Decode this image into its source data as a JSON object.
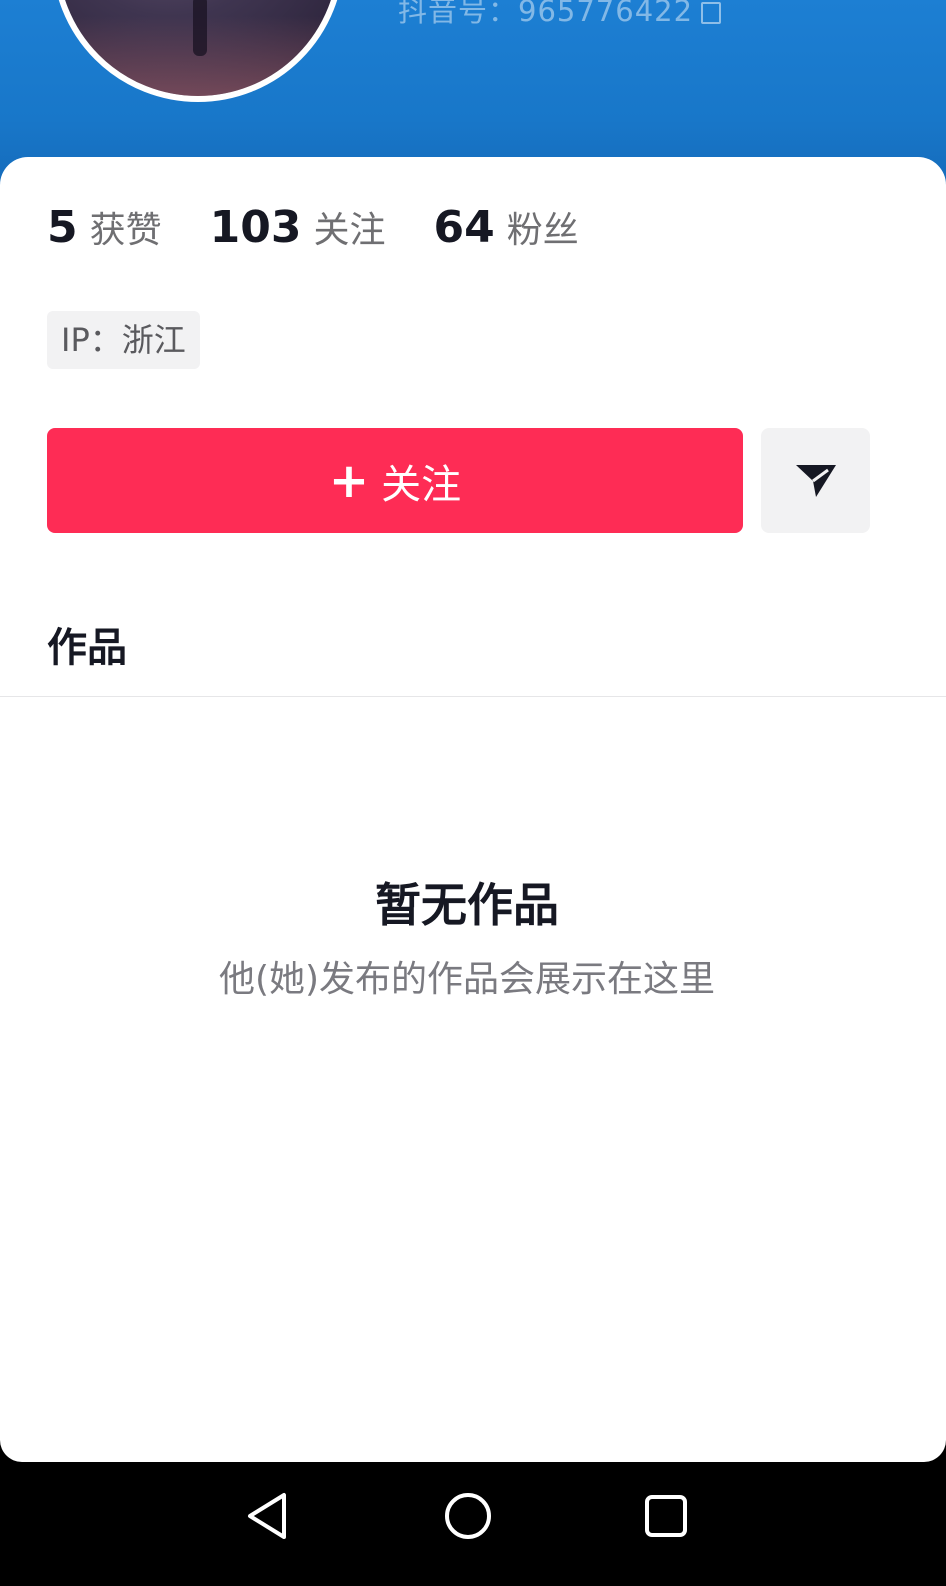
{
  "header": {
    "account_id": "抖音号：965776422",
    "avatar_icon": "avatar-image",
    "copy_icon": "copy-icon"
  },
  "stats": [
    {
      "value": "5",
      "label": "获赞"
    },
    {
      "value": "103",
      "label": "关注"
    },
    {
      "value": "64",
      "label": "粉丝"
    }
  ],
  "ip_location": "IP：浙江",
  "actions": {
    "follow_icon": "+",
    "follow_label": "关注",
    "message_icon": "send-icon"
  },
  "tabs": {
    "works_label": "作品"
  },
  "empty_state": {
    "title": "暂无作品",
    "subtitle": "他(她)发布的作品会展示在这里"
  },
  "nav": {
    "back_icon": "back-triangle-icon",
    "home_icon": "home-circle-icon",
    "recents_icon": "recents-square-icon"
  },
  "colors": {
    "header_blue": "#1877c9",
    "accent_red": "#fe2c55",
    "text_dark": "#161823"
  }
}
